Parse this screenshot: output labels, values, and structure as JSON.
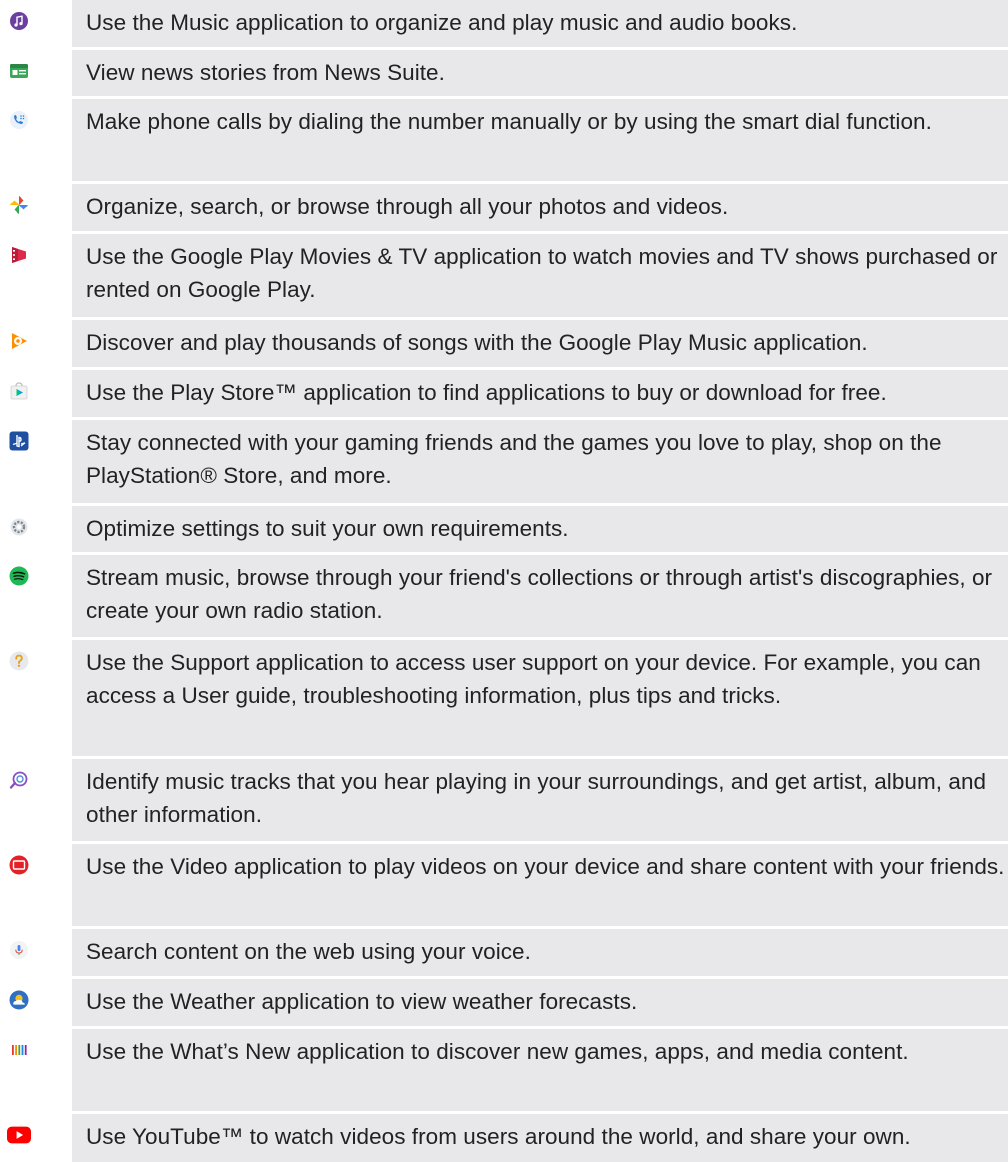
{
  "apps": [
    {
      "icon": "music-icon",
      "description": "Use the Music application to organize and play music and audio books."
    },
    {
      "icon": "news-suite-icon",
      "description": "View news stories from News Suite."
    },
    {
      "icon": "phone-icon",
      "description": "Make phone calls by dialing the number manually or by using the smart dial function."
    },
    {
      "icon": "photos-icon",
      "description": "Organize, search, or browse through all your photos and videos."
    },
    {
      "icon": "play-movies-icon",
      "description": "Use the Google Play Movies & TV application to watch movies and TV shows purchased or rented on Google Play."
    },
    {
      "icon": "play-music-icon",
      "description": "Discover and play thousands of songs with the Google Play Music application."
    },
    {
      "icon": "play-store-icon",
      "description": "Use the Play Store™ application to find applications to buy or download for free."
    },
    {
      "icon": "playstation-icon",
      "description": "Stay connected with your gaming friends and the games you love to play, shop on the PlayStation® Store, and more."
    },
    {
      "icon": "settings-icon",
      "description": "Optimize settings to suit your own requirements."
    },
    {
      "icon": "spotify-icon",
      "description": "Stream music, browse through your friend's collections or through artist's discographies, or create your own radio station."
    },
    {
      "icon": "support-icon",
      "description": "Use the Support application to access user support on your device. For example, you can access a User guide, troubleshooting information, plus tips and tricks."
    },
    {
      "icon": "trackid-icon",
      "description": "Identify music tracks that you hear playing in your surroundings, and get artist, album, and other information."
    },
    {
      "icon": "video-icon",
      "description": "Use the Video application to play videos on your device and share content with your friends."
    },
    {
      "icon": "voice-search-icon",
      "description": "Search content on the web using your voice."
    },
    {
      "icon": "weather-icon",
      "description": "Use the Weather application to view weather forecasts."
    },
    {
      "icon": "whats-new-icon",
      "description": "Use the What’s New application to discover new games, apps, and media content."
    },
    {
      "icon": "youtube-icon",
      "description": "Use YouTube™ to watch videos from users around the world, and share your own."
    }
  ]
}
